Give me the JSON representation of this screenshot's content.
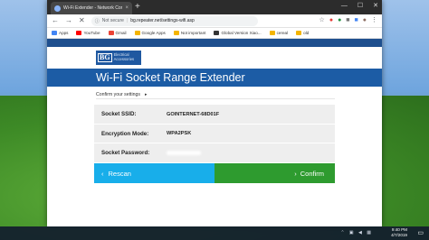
{
  "browser": {
    "tab_title": "Wi-Fi Extender - Network Confi",
    "tab_close": "×",
    "new_tab": "+",
    "window_controls": [
      "—",
      "☐",
      "✕"
    ],
    "security_label": "Not secure",
    "address": "bg.repeater.net/settings-wifi.asp",
    "bookmarks": [
      {
        "label": "Apps",
        "color": "#4285f4"
      },
      {
        "label": "YouTube",
        "color": "#ff0000"
      },
      {
        "label": "Gmail",
        "color": "#ea4335"
      },
      {
        "label": "Google Apps",
        "color": "#f4b400"
      },
      {
        "label": "Not important",
        "color": "#f4b400"
      },
      {
        "label": "Global Version Xiao...",
        "color": "#333333"
      },
      {
        "label": "cereal",
        "color": "#f4b400"
      },
      {
        "label": "old",
        "color": "#f4b400"
      }
    ]
  },
  "page": {
    "logo_mark": "BG",
    "logo_text_line1": "Electrical",
    "logo_text_line2": "Accessories",
    "title": "Wi-Fi Socket Range Extender",
    "breadcrumb": "Confirm your settings",
    "breadcrumb_arrow": "▸",
    "fields": [
      {
        "label": "Socket SSID:",
        "value": "GOINTERNET-68D01F"
      },
      {
        "label": "Encryption Mode:",
        "value": "WPA2PSK"
      },
      {
        "label": "Socket Password:",
        "value": ""
      }
    ],
    "rescan_label": "Rescan",
    "rescan_icon": "‹",
    "confirm_label": "Confirm",
    "confirm_icon": "›"
  },
  "taskbar": {
    "time": "9:40 PM",
    "date": "4/7/2019",
    "tray_icons": "⌃ ▣ ◀ ▦"
  },
  "colors": {
    "header_blue": "#1c5ca5",
    "rescan": "#18aeea",
    "confirm": "#2e9b2f"
  }
}
